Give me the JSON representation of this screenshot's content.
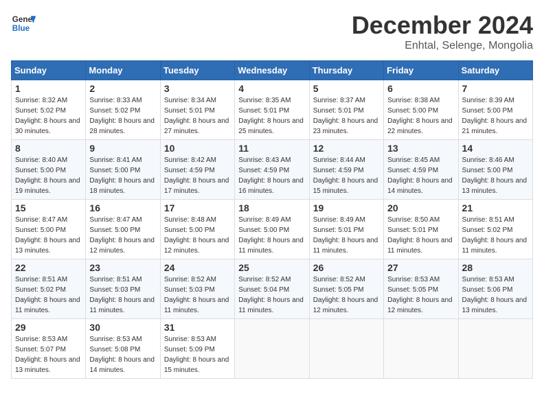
{
  "header": {
    "logo_line1": "General",
    "logo_line2": "Blue",
    "month_title": "December 2024",
    "location": "Enhtal, Selenge, Mongolia"
  },
  "weekdays": [
    "Sunday",
    "Monday",
    "Tuesday",
    "Wednesday",
    "Thursday",
    "Friday",
    "Saturday"
  ],
  "weeks": [
    [
      {
        "day": "1",
        "sunrise": "8:32 AM",
        "sunset": "5:02 PM",
        "daylight": "8 hours and 30 minutes."
      },
      {
        "day": "2",
        "sunrise": "8:33 AM",
        "sunset": "5:02 PM",
        "daylight": "8 hours and 28 minutes."
      },
      {
        "day": "3",
        "sunrise": "8:34 AM",
        "sunset": "5:01 PM",
        "daylight": "8 hours and 27 minutes."
      },
      {
        "day": "4",
        "sunrise": "8:35 AM",
        "sunset": "5:01 PM",
        "daylight": "8 hours and 25 minutes."
      },
      {
        "day": "5",
        "sunrise": "8:37 AM",
        "sunset": "5:01 PM",
        "daylight": "8 hours and 23 minutes."
      },
      {
        "day": "6",
        "sunrise": "8:38 AM",
        "sunset": "5:00 PM",
        "daylight": "8 hours and 22 minutes."
      },
      {
        "day": "7",
        "sunrise": "8:39 AM",
        "sunset": "5:00 PM",
        "daylight": "8 hours and 21 minutes."
      }
    ],
    [
      {
        "day": "8",
        "sunrise": "8:40 AM",
        "sunset": "5:00 PM",
        "daylight": "8 hours and 19 minutes."
      },
      {
        "day": "9",
        "sunrise": "8:41 AM",
        "sunset": "5:00 PM",
        "daylight": "8 hours and 18 minutes."
      },
      {
        "day": "10",
        "sunrise": "8:42 AM",
        "sunset": "4:59 PM",
        "daylight": "8 hours and 17 minutes."
      },
      {
        "day": "11",
        "sunrise": "8:43 AM",
        "sunset": "4:59 PM",
        "daylight": "8 hours and 16 minutes."
      },
      {
        "day": "12",
        "sunrise": "8:44 AM",
        "sunset": "4:59 PM",
        "daylight": "8 hours and 15 minutes."
      },
      {
        "day": "13",
        "sunrise": "8:45 AM",
        "sunset": "4:59 PM",
        "daylight": "8 hours and 14 minutes."
      },
      {
        "day": "14",
        "sunrise": "8:46 AM",
        "sunset": "5:00 PM",
        "daylight": "8 hours and 13 minutes."
      }
    ],
    [
      {
        "day": "15",
        "sunrise": "8:47 AM",
        "sunset": "5:00 PM",
        "daylight": "8 hours and 13 minutes."
      },
      {
        "day": "16",
        "sunrise": "8:47 AM",
        "sunset": "5:00 PM",
        "daylight": "8 hours and 12 minutes."
      },
      {
        "day": "17",
        "sunrise": "8:48 AM",
        "sunset": "5:00 PM",
        "daylight": "8 hours and 12 minutes."
      },
      {
        "day": "18",
        "sunrise": "8:49 AM",
        "sunset": "5:00 PM",
        "daylight": "8 hours and 11 minutes."
      },
      {
        "day": "19",
        "sunrise": "8:49 AM",
        "sunset": "5:01 PM",
        "daylight": "8 hours and 11 minutes."
      },
      {
        "day": "20",
        "sunrise": "8:50 AM",
        "sunset": "5:01 PM",
        "daylight": "8 hours and 11 minutes."
      },
      {
        "day": "21",
        "sunrise": "8:51 AM",
        "sunset": "5:02 PM",
        "daylight": "8 hours and 11 minutes."
      }
    ],
    [
      {
        "day": "22",
        "sunrise": "8:51 AM",
        "sunset": "5:02 PM",
        "daylight": "8 hours and 11 minutes."
      },
      {
        "day": "23",
        "sunrise": "8:51 AM",
        "sunset": "5:03 PM",
        "daylight": "8 hours and 11 minutes."
      },
      {
        "day": "24",
        "sunrise": "8:52 AM",
        "sunset": "5:03 PM",
        "daylight": "8 hours and 11 minutes."
      },
      {
        "day": "25",
        "sunrise": "8:52 AM",
        "sunset": "5:04 PM",
        "daylight": "8 hours and 11 minutes."
      },
      {
        "day": "26",
        "sunrise": "8:52 AM",
        "sunset": "5:05 PM",
        "daylight": "8 hours and 12 minutes."
      },
      {
        "day": "27",
        "sunrise": "8:53 AM",
        "sunset": "5:05 PM",
        "daylight": "8 hours and 12 minutes."
      },
      {
        "day": "28",
        "sunrise": "8:53 AM",
        "sunset": "5:06 PM",
        "daylight": "8 hours and 13 minutes."
      }
    ],
    [
      {
        "day": "29",
        "sunrise": "8:53 AM",
        "sunset": "5:07 PM",
        "daylight": "8 hours and 13 minutes."
      },
      {
        "day": "30",
        "sunrise": "8:53 AM",
        "sunset": "5:08 PM",
        "daylight": "8 hours and 14 minutes."
      },
      {
        "day": "31",
        "sunrise": "8:53 AM",
        "sunset": "5:09 PM",
        "daylight": "8 hours and 15 minutes."
      },
      null,
      null,
      null,
      null
    ]
  ]
}
